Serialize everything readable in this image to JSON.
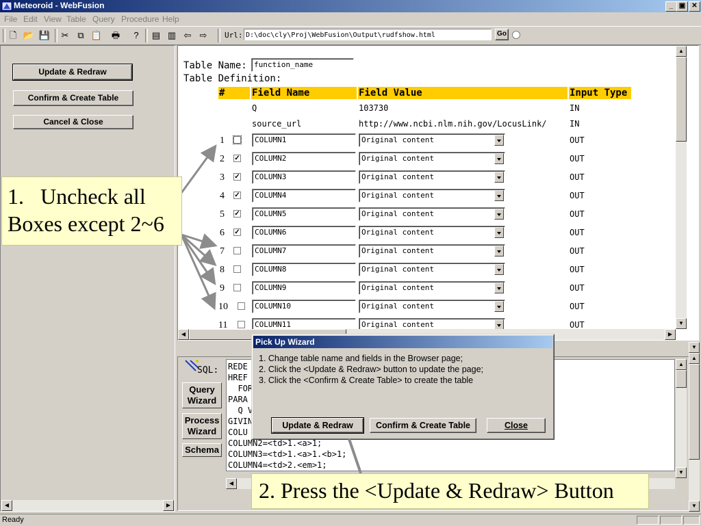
{
  "window": {
    "title": "Meteoroid - WebFusion",
    "btn_min": "_",
    "btn_max": "▣",
    "btn_close": "✕"
  },
  "menu": [
    {
      "label": "File"
    },
    {
      "label": "Edit"
    },
    {
      "label": "View"
    },
    {
      "label": "Table"
    },
    {
      "label": "Query"
    },
    {
      "label": "Procedure"
    },
    {
      "label": "Help"
    }
  ],
  "toolbar": {
    "icons": [
      "new-file-icon",
      "open-folder-icon",
      "save-icon",
      "cut-icon",
      "copy-icon",
      "paste-icon",
      "print-icon",
      "help-icon",
      "panel-icon",
      "panel2-icon",
      "back-arrow-icon",
      "forward-arrow-icon"
    ],
    "glyphs": [
      "🗋",
      "📂",
      "💾",
      "✂",
      "⧉",
      "📋",
      "🖶",
      "?",
      "▤",
      "▥",
      "⇦",
      "⇨"
    ],
    "url_label": "Url:",
    "url_value": "D:\\doc\\cly\\Proj\\WebFusion\\Output\\rudfshow.html",
    "go_label": "Go"
  },
  "left_panel": {
    "update_redraw": "Update & Redraw",
    "confirm_create": "Confirm & Create Table",
    "cancel_close": "Cancel & Close"
  },
  "browser": {
    "table_name_label": "Table Name:",
    "table_name_value": "function_name",
    "table_definition_label": "Table Definition:",
    "headers": [
      "#",
      "Field Name",
      "Field Value",
      "Input Type"
    ],
    "input_rows": [
      {
        "name": "Q",
        "value": "103730",
        "type": "IN"
      },
      {
        "name": "source_url",
        "value": "http://www.ncbi.nlm.nih.gov/LocusLink/",
        "type": "IN"
      }
    ],
    "rows": [
      {
        "num": "1",
        "checked": false,
        "name": "COLUMN1",
        "value": "Original content",
        "type": "OUT"
      },
      {
        "num": "2",
        "checked": true,
        "name": "COLUMN2",
        "value": "Original content",
        "type": "OUT"
      },
      {
        "num": "3",
        "checked": true,
        "name": "COLUMN3",
        "value": "Original content",
        "type": "OUT"
      },
      {
        "num": "4",
        "checked": true,
        "name": "COLUMN4",
        "value": "Original content",
        "type": "OUT"
      },
      {
        "num": "5",
        "checked": true,
        "name": "COLUMN5",
        "value": "Original content",
        "type": "OUT"
      },
      {
        "num": "6",
        "checked": true,
        "name": "COLUMN6",
        "value": "Original content",
        "type": "OUT"
      },
      {
        "num": "7",
        "checked": false,
        "name": "COLUMN7",
        "value": "Original content",
        "type": "OUT"
      },
      {
        "num": "8",
        "checked": false,
        "name": "COLUMN8",
        "value": "Original content",
        "type": "OUT"
      },
      {
        "num": "9",
        "checked": false,
        "name": "COLUMN9",
        "value": "Original content",
        "type": "OUT"
      },
      {
        "num": "10",
        "checked": false,
        "name": "COLUMN10",
        "value": "Original content",
        "type": "OUT"
      },
      {
        "num": "11",
        "checked": false,
        "name": "COLUMN11",
        "value": "Original content",
        "type": "OUT"
      }
    ]
  },
  "sql_panel": {
    "sql_label": "SQL:",
    "query_wizard": "Query\nWizard",
    "process_wizard": "Process\nWizard",
    "schema": "Schema",
    "lines": [
      "REDE",
      "HREF",
      "  FOR",
      "PARA",
      "  Q V",
      "GIVIN",
      "COLU",
      "COLUMN2=<td>1.<a>1;",
      "COLUMN3=<td>1.<a>1.<b>1;",
      "COLUMN4=<td>2.<em>1;"
    ]
  },
  "dialog": {
    "title": "Pick Up Wizard",
    "lines": [
      "1. Change table name and fields in the Browser page;",
      "2. Click the <Update & Redraw> button to update the page;",
      "3. Click the <Confirm & Create Table> to create the table"
    ],
    "update_redraw": "Update & Redraw",
    "confirm_create": "Confirm & Create Table",
    "close": "Close"
  },
  "callouts": {
    "step1_line1": "1.   Uncheck all",
    "step1_line2": "Boxes except 2~6",
    "step2": "2. Press the <Update & Redraw> Button"
  },
  "status": {
    "text": "Ready"
  },
  "colors": {
    "header_bg": "#ffcc00",
    "callout_bg": "#ffffcc",
    "arrow": "#8c8c8c",
    "title_start": "#0a246a"
  }
}
